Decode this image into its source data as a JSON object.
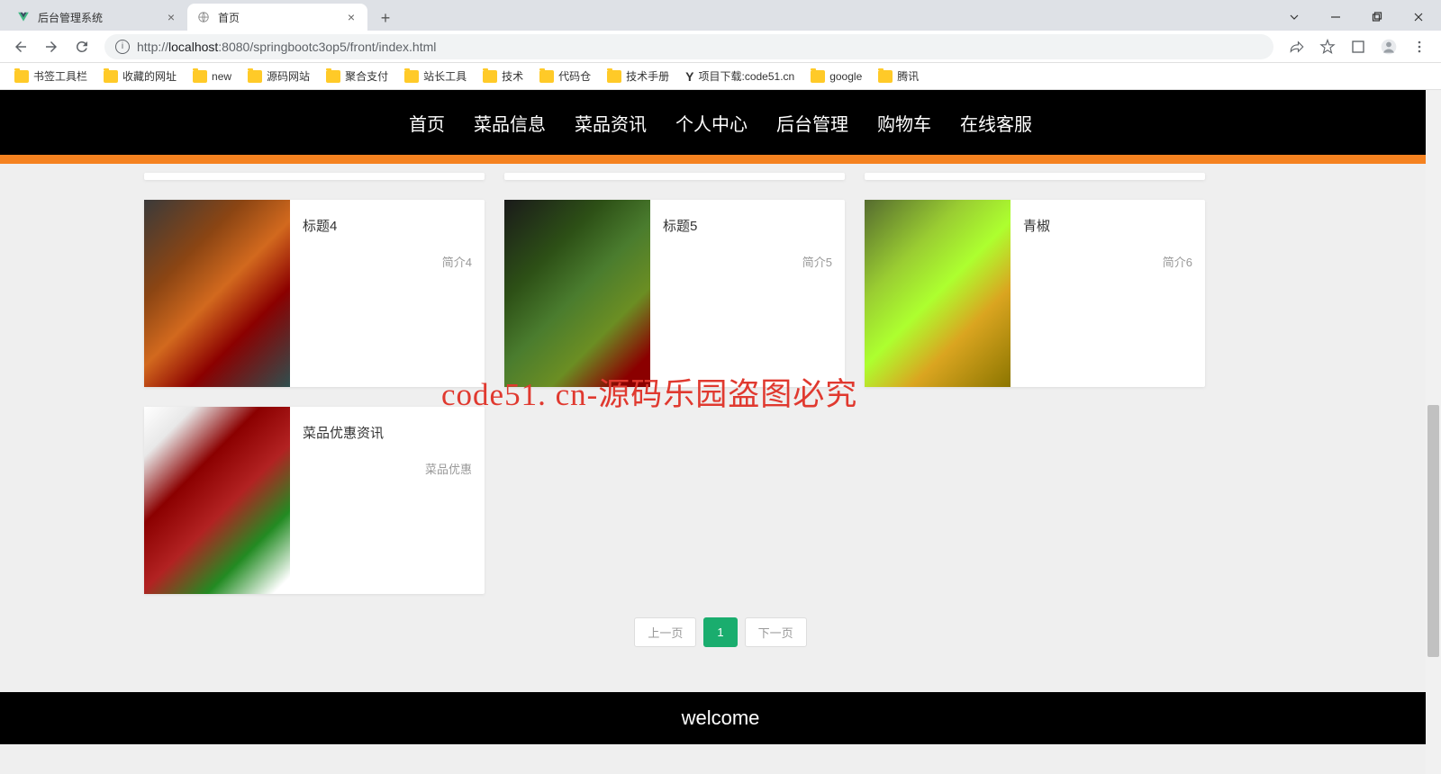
{
  "browser": {
    "tabs": [
      {
        "title": "后台管理系统",
        "active": false
      },
      {
        "title": "首页",
        "active": true
      }
    ],
    "url_prefix": "http://",
    "url_host": "localhost",
    "url_port": ":8080",
    "url_path": "/springbootc3op5/front/index.html",
    "bookmarks": [
      {
        "label": "书签工具栏"
      },
      {
        "label": "收藏的网址"
      },
      {
        "label": "new"
      },
      {
        "label": "源码网站"
      },
      {
        "label": "聚合支付"
      },
      {
        "label": "站长工具"
      },
      {
        "label": "技术"
      },
      {
        "label": "代码仓"
      },
      {
        "label": "技术手册"
      },
      {
        "label": "项目下载:code51.cn",
        "special": true
      },
      {
        "label": "google"
      },
      {
        "label": "腾讯"
      }
    ]
  },
  "nav": {
    "items": [
      {
        "label": "首页"
      },
      {
        "label": "菜品信息"
      },
      {
        "label": "菜品资讯"
      },
      {
        "label": "个人中心"
      },
      {
        "label": "后台管理"
      },
      {
        "label": "购物车"
      },
      {
        "label": "在线客服"
      }
    ]
  },
  "cards": [
    {
      "title": "标题4",
      "desc": "简介4",
      "img": "food-1"
    },
    {
      "title": "标题5",
      "desc": "简介5",
      "img": "food-2"
    },
    {
      "title": "青椒",
      "desc": "简介6",
      "img": "food-3"
    },
    {
      "title": "菜品优惠资讯",
      "desc": "菜品优惠",
      "img": "food-4"
    }
  ],
  "pager": {
    "prev": "上一页",
    "current": "1",
    "next": "下一页"
  },
  "footer": "welcome",
  "watermark": "code51. cn-源码乐园盗图必究"
}
